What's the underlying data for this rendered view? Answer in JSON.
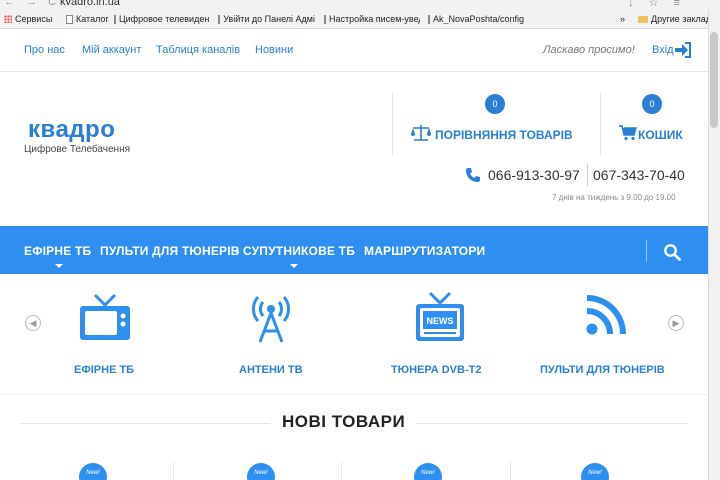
{
  "browser": {
    "url": "kvadro.in.ua",
    "nav_glyphs": "← → C",
    "right_glyphs": "↓ ☆ ≡",
    "bookmarks": [
      "Сервисы",
      "Каталог",
      "Цифровое телевиден",
      "Увійти до Панелі Адмі",
      "Настройка писем-увед",
      "Ak_NovaPoshta/config",
      "Другие закладки"
    ],
    "more_glyph": "»"
  },
  "top_nav": {
    "links": [
      "Про нас",
      "Мій аккаунт",
      "Таблиця каналів",
      "Новини"
    ],
    "welcome": "Ласкаво просимо!",
    "login": "Вхід"
  },
  "header": {
    "logo": "квадро",
    "tagline": "Цифрове Телебачення",
    "compare": {
      "label": "ПОРІВНЯННЯ ТОВАРІВ",
      "count": "0"
    },
    "cart": {
      "label": "КОШИК",
      "count": "0"
    },
    "phones": [
      "066-913-30-97",
      "067-343-70-40"
    ],
    "hours": "7 днів на тиждень з 9.00 до 19.00"
  },
  "main_nav": {
    "items": [
      "ЕФІРНЕ ТБ",
      "ПУЛЬТИ ДЛЯ ТЮНЕРІВ",
      "• СУПУТНИКОВЕ ТБ",
      "МАРШРУТИЗАТОРИ"
    ]
  },
  "categories": {
    "prev_glyph": "◀",
    "next_glyph": "▶",
    "items": [
      {
        "label": "ЕФІРНЕ ТБ",
        "icon": "tv-icon"
      },
      {
        "label": "АНТЕНИ ТВ",
        "icon": "antenna-icon"
      },
      {
        "label": "ТЮНЕРА DVB-T2",
        "icon": "news-tv-icon"
      },
      {
        "label": "ПУЛЬТИ ДЛЯ ТЮНЕРІВ",
        "icon": "rss-icon"
      }
    ]
  },
  "new_products": {
    "title": "НОВІ ТОВАРИ",
    "badge": "New!"
  },
  "colors": {
    "accent": "#2a7fd4",
    "nav_bg": "#2e8ff0"
  }
}
